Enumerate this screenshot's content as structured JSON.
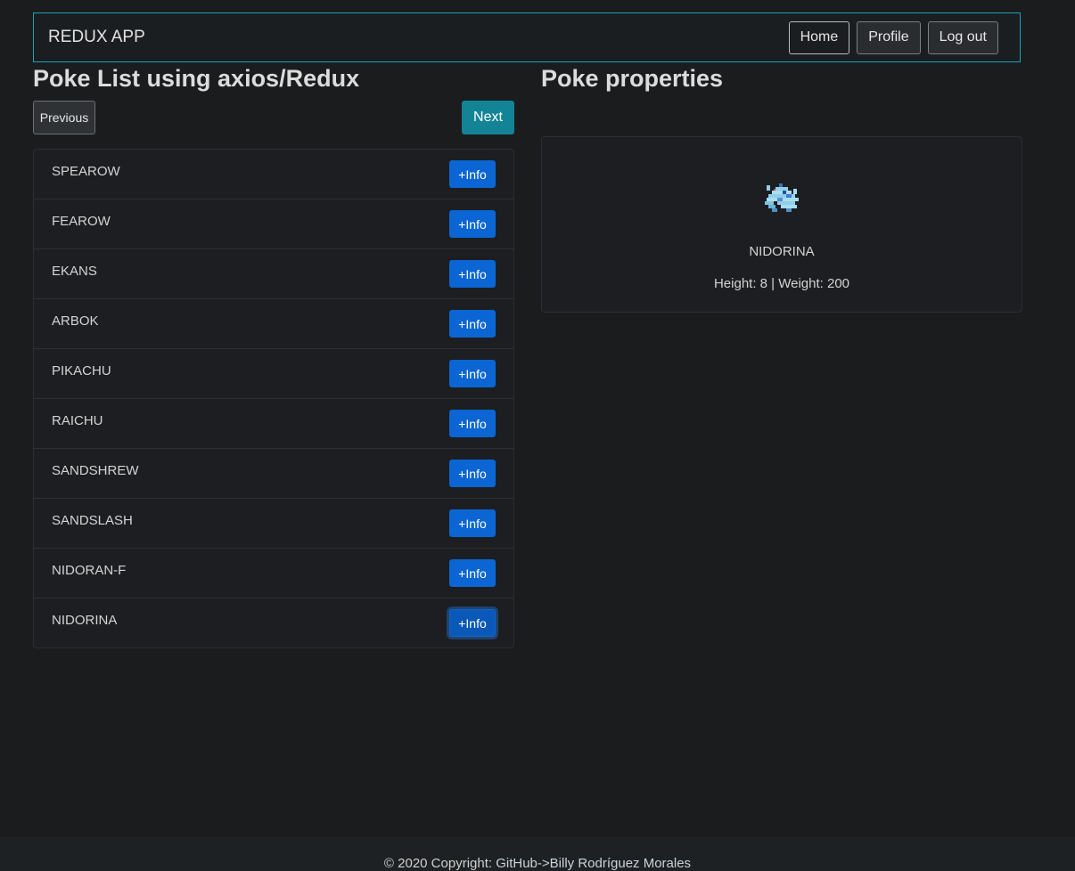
{
  "navbar": {
    "brand": "REDUX APP",
    "buttons": [
      "Home",
      "Profile",
      "Log out"
    ]
  },
  "list_section": {
    "title": "Poke List using axios/Redux",
    "previous_label": "Previous",
    "next_label": "Next",
    "info_label": "+Info",
    "items": [
      "SPEAROW",
      "FEAROW",
      "EKANS",
      "ARBOK",
      "PIKACHU",
      "RAICHU",
      "SANDSHREW",
      "SANDSLASH",
      "NIDORAN-F",
      "NIDORINA"
    ],
    "focused_item": "NIDORINA"
  },
  "properties_section": {
    "title": "Poke properties",
    "name": "NIDORINA",
    "height_label": "Height: ",
    "height": "8",
    "separator": " | ",
    "weight_label": "Weight: ",
    "weight": "200",
    "sprite_icon": "nidorina-sprite-icon"
  },
  "footer": {
    "copyright": "© 2020 Copyright: ",
    "link_text": "GitHub->Billy Rodríguez Morales"
  },
  "colors": {
    "background": "#1a1c1e",
    "navbar_border": "#17a2b8",
    "next_button": "#138496",
    "info_button": "#0b66d4"
  }
}
